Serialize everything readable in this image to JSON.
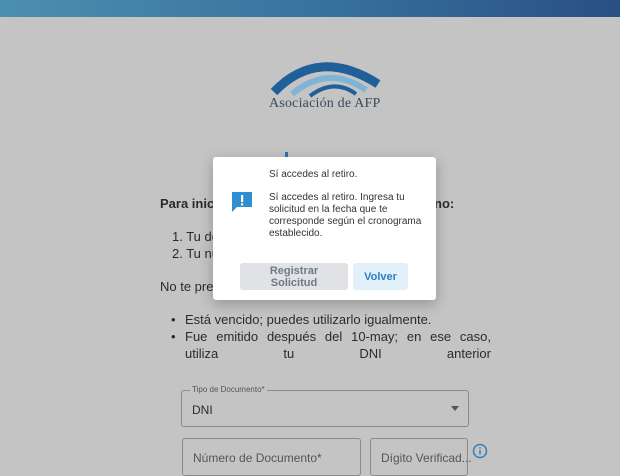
{
  "brand": {
    "logo_text": "Asociación de AFP",
    "accent_color": "#2f6fb6",
    "arc_colors": [
      "#1f5f9a",
      "#7fb3d8"
    ]
  },
  "page": {
    "intro_left": "Para inicia",
    "intro_right": "no:",
    "list_item_1": "1. Tu do",
    "list_item_2": "2. Tu nú",
    "no_preocupes": "No te preo",
    "bullet_1": "Está vencido; puedes utilizarlo igualmente.",
    "bullet_2": "Fue emitido después del 10-may; en ese caso, utiliza tu DNI anterior"
  },
  "form": {
    "tipo_documento": {
      "label": "Tipo de Documento*",
      "value": "DNI",
      "icon": "dropdown-arrow-icon"
    },
    "numero_documento": {
      "placeholder": "Número de Documento*"
    },
    "digito_verificador": {
      "placeholder": "Dígito Verificad..."
    },
    "info_icon": "info-circle-icon"
  },
  "modal": {
    "icon": "feedback-alert-icon",
    "title": "Sí accedes al retiro.",
    "body": "Sí accedes al retiro. Ingresa tu solicitud en la fecha que te corresponde según el cronograma establecido.",
    "register_label": "Registrar Solicitud",
    "back_label": "Volver"
  }
}
